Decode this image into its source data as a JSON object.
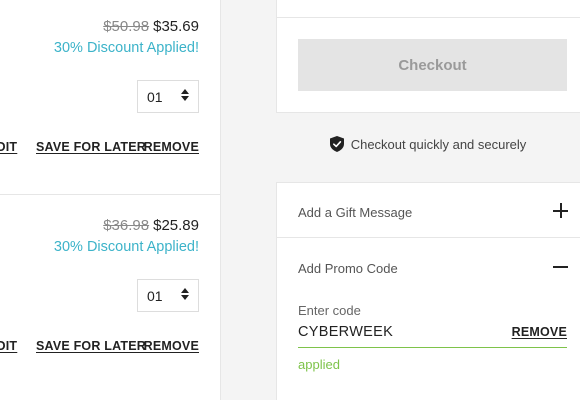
{
  "cart_items": [
    {
      "old_price": "$50.98",
      "new_price": "$35.69",
      "discount": "30% Discount Applied!",
      "quantity": "01",
      "edit_label": "EDIT",
      "save_label": "SAVE FOR LATER",
      "remove_label": "REMOVE"
    },
    {
      "old_price": "$36.98",
      "new_price": "$25.89",
      "discount": "30% Discount Applied!",
      "quantity": "01",
      "edit_label": "EDIT",
      "save_label": "SAVE FOR LATER",
      "remove_label": "REMOVE"
    }
  ],
  "summary": {
    "checkout_label": "Checkout",
    "secure_text": "Checkout quickly and securely",
    "gift_message_label": "Add a Gift Message",
    "promo_label": "Add Promo Code",
    "promo": {
      "field_label": "Enter code",
      "code": "CYBERWEEK",
      "remove_label": "REMOVE",
      "status": "applied"
    }
  },
  "colors": {
    "discount": "#3cb3c9",
    "applied": "#7ec34a",
    "panel_bg": "#f4f4f4",
    "checkout_disabled_bg": "#e4e4e4"
  },
  "icons": {
    "secure": "shield-check-icon",
    "gift_toggle": "plus-icon",
    "promo_toggle": "minus-icon",
    "quantity": "stepper-arrows-icon"
  }
}
